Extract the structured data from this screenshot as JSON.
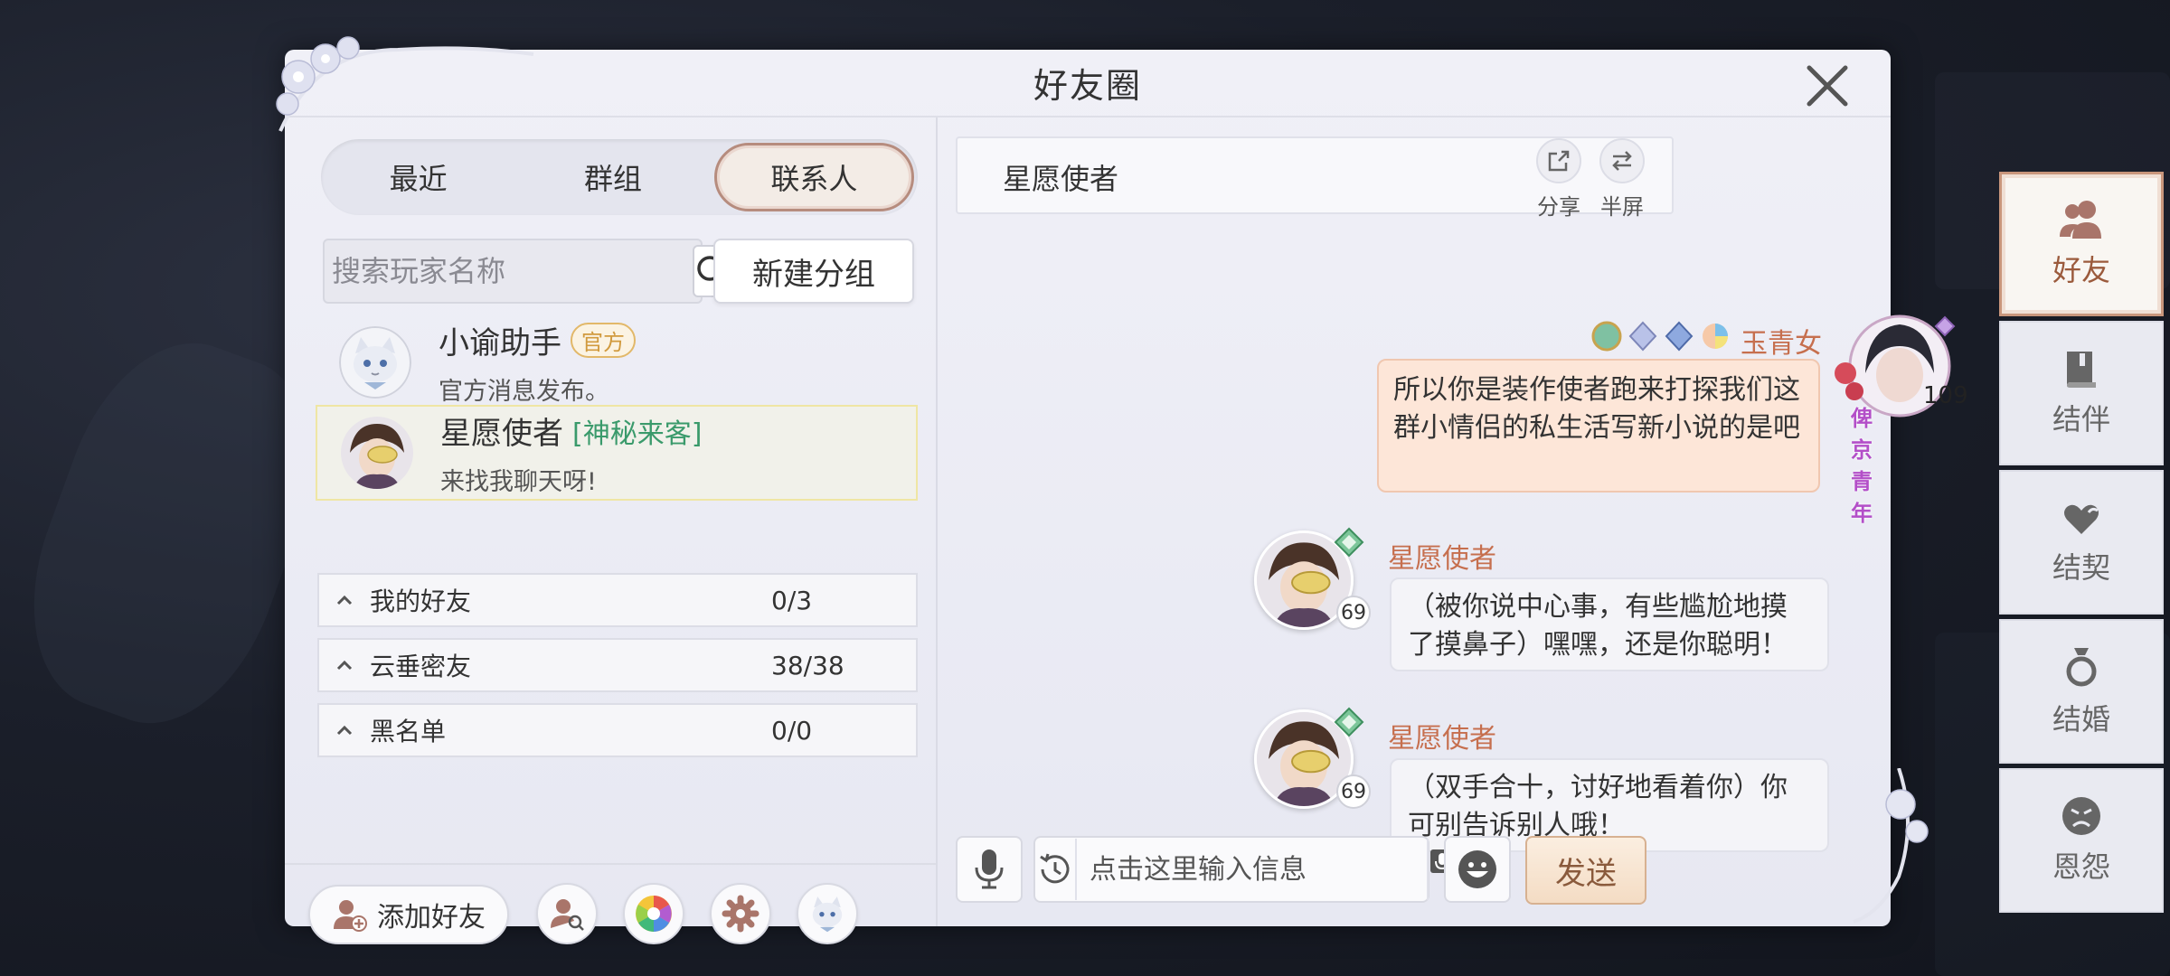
{
  "panel": {
    "title": "好友圈"
  },
  "tabs": [
    {
      "label": "最近",
      "active": false
    },
    {
      "label": "群组",
      "active": false
    },
    {
      "label": "联系人",
      "active": true
    }
  ],
  "search": {
    "placeholder": "搜索玩家名称"
  },
  "new_group_label": "新建分组",
  "contacts": [
    {
      "name": "小谕助手",
      "tag": "官方",
      "subtitle": "官方消息发布。"
    },
    {
      "name": "星愿使者",
      "tag": "[神秘来客]",
      "subtitle": "来找我聊天呀!"
    }
  ],
  "groups": [
    {
      "label": "我的好友",
      "count": "0/3"
    },
    {
      "label": "云垂密友",
      "count": "38/38"
    },
    {
      "label": "黑名单",
      "count": "0/0"
    }
  ],
  "bottom_actions": {
    "add_friend_label": "添加好友"
  },
  "chat": {
    "title": "星愿使者",
    "share_label": "分享",
    "halfscreen_label": "半屏",
    "messages": [
      {
        "sender": "玉青女",
        "self": true,
        "level": "109",
        "plate_text": "俾京青年",
        "text": "所以你是装作使者跑来打探我们这群小情侣的私生活写新小说的是吧"
      },
      {
        "sender": "星愿使者",
        "self": false,
        "level": "69",
        "text": "（被你说中心事，有些尴尬地摸了摸鼻子）嘿嘿，还是你聪明！"
      },
      {
        "sender": "星愿使者",
        "self": false,
        "level": "69",
        "text": "（双手合十，讨好地看着你）你可别告诉别人哦！"
      }
    ],
    "input_placeholder": "点击这里输入信息",
    "send_label": "发送"
  },
  "right_nav": [
    {
      "label": "好友",
      "active": true
    },
    {
      "label": "结伴",
      "active": false
    },
    {
      "label": "结契",
      "active": false
    },
    {
      "label": "结婚",
      "active": false
    },
    {
      "label": "恩怨",
      "active": false
    }
  ],
  "colors": {
    "accent_name": "#c66f4e",
    "mystery_tag": "#3a9a6b",
    "official_tag": "#d19a3e",
    "self_bubble": "#fde6d8",
    "active_border": "#c9967c"
  }
}
